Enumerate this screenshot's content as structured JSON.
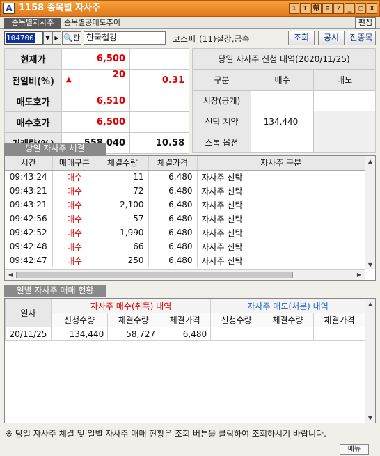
{
  "window": {
    "title": "1158 종목별 자사주",
    "app_icon": "A",
    "buttons": [
      "1",
      "T",
      "帶",
      "?",
      "_",
      "□",
      "X"
    ]
  },
  "tabs": {
    "active": "종목별자사주",
    "other": "종목별공매도추이",
    "edit": "편집"
  },
  "search": {
    "code": "104700",
    "name": "한국철강",
    "market": "코스피",
    "sector": "(11)철강,금속",
    "query_btn": "조회",
    "notice_btn": "공시",
    "all_btn": "전종목"
  },
  "quote": [
    {
      "label": "현재가",
      "value": "6,500",
      "extra": ""
    },
    {
      "label": "전일비(%)",
      "arrow": "▲",
      "value": "20",
      "extra": "0.31"
    },
    {
      "label": "매도호가",
      "value": "6,510",
      "extra": ""
    },
    {
      "label": "매수호가",
      "value": "6,500",
      "extra": ""
    },
    {
      "label": "거래량(%)",
      "value": "558,040",
      "extra": "10.58"
    }
  ],
  "contract": {
    "title": "당일 자사주 신청 내역(2020/11/25)",
    "headers": [
      "구분",
      "매수",
      "매도"
    ],
    "rows": [
      {
        "label": "시장(공개)",
        "buy": "",
        "sell": ""
      },
      {
        "label": "신탁 계약",
        "buy": "134,440",
        "sell": ""
      },
      {
        "label": "스톡 옵션",
        "buy": "",
        "sell": ""
      }
    ]
  },
  "exec": {
    "section": "당일 자사주 체결",
    "headers": [
      "시간",
      "매매구분",
      "체결수량",
      "체결가격",
      "자사주 구분"
    ],
    "rows": [
      {
        "time": "09:43:24",
        "side": "매수",
        "qty": "11",
        "price": "6,480",
        "kind": "자사주 신탁"
      },
      {
        "time": "09:43:21",
        "side": "매수",
        "qty": "72",
        "price": "6,480",
        "kind": "자사주 신탁"
      },
      {
        "time": "09:43:21",
        "side": "매수",
        "qty": "2,100",
        "price": "6,480",
        "kind": "자사주 신탁"
      },
      {
        "time": "09:42:56",
        "side": "매수",
        "qty": "57",
        "price": "6,480",
        "kind": "자사주 신탁"
      },
      {
        "time": "09:42:52",
        "side": "매수",
        "qty": "1,990",
        "price": "6,480",
        "kind": "자사주 신탁"
      },
      {
        "time": "09:42:48",
        "side": "매수",
        "qty": "66",
        "price": "6,480",
        "kind": "자사주 신탁"
      },
      {
        "time": "09:42:47",
        "side": "매수",
        "qty": "250",
        "price": "6,480",
        "kind": "자사주 신탁"
      }
    ]
  },
  "daily": {
    "section": "일별 자사주 매매 현황",
    "date_header": "일자",
    "buy_group": "자사주 매수(취득) 내역",
    "sell_group": "자사주 매도(처분) 내역",
    "sub": [
      "신청수량",
      "체결수량",
      "체결가격",
      "신청수량",
      "체결수량",
      "체결가격"
    ],
    "rows": [
      {
        "date": "20/11/25",
        "cells": [
          "134,440",
          "58,727",
          "6,480",
          "",
          "",
          ""
        ]
      }
    ]
  },
  "footer": "※ 당일 자사주 체결 및 일별 자사주 매매 현황은 조회 버튼을 클릭하여 조회하시기 바랍니다.",
  "menu": "메뉴"
}
